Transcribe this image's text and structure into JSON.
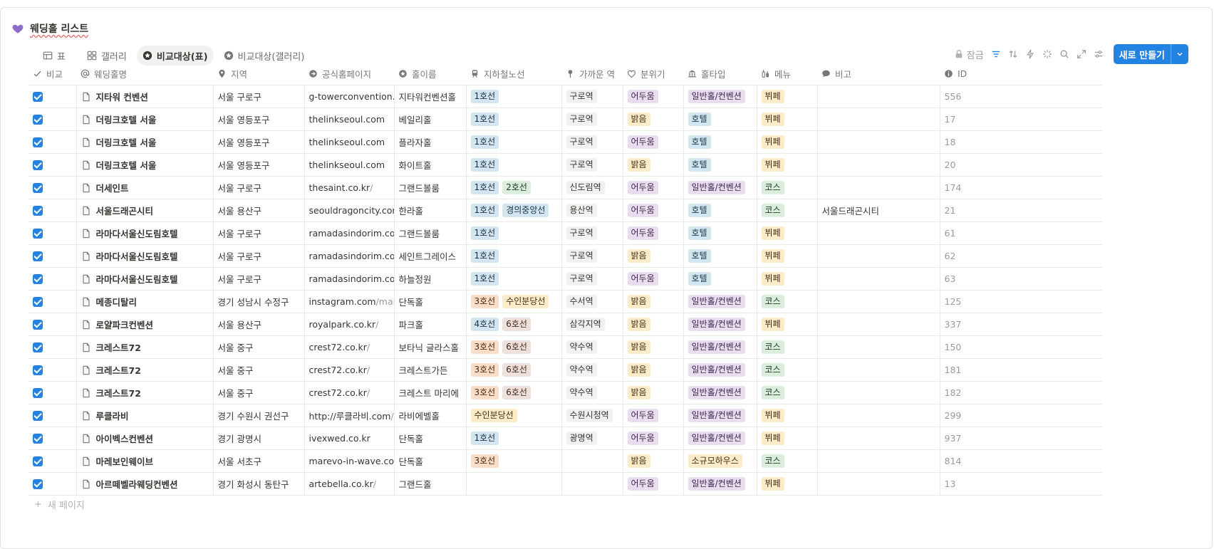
{
  "page": {
    "title": "웨딩홀 리스트",
    "icon": "purple-heart-icon",
    "accent": "#2383e2"
  },
  "views": [
    {
      "label": "표",
      "icon": "table-icon",
      "active": false
    },
    {
      "label": "갤러리",
      "icon": "gallery-icon",
      "active": false
    },
    {
      "label": "비교대상(표)",
      "icon": "star-circle-icon",
      "active": true
    },
    {
      "label": "비교대상(갤러리)",
      "icon": "star-circle-icon",
      "active": false
    }
  ],
  "toolbar": {
    "lock_label": "잠금",
    "new_label": "새로 만들기"
  },
  "columns": [
    {
      "label": "비교",
      "icon": "check-icon"
    },
    {
      "label": "웨딩홀명",
      "icon": "at-icon"
    },
    {
      "label": "지역",
      "icon": "pin-icon"
    },
    {
      "label": "공식홈페이지",
      "icon": "arrow-circle-icon"
    },
    {
      "label": "홀이름",
      "icon": "star-circle-icon"
    },
    {
      "label": "지하철노선",
      "icon": "train-icon"
    },
    {
      "label": "가까운 역",
      "icon": "pin-icon"
    },
    {
      "label": "분위기",
      "icon": "heart-outline-icon"
    },
    {
      "label": "홀타입",
      "icon": "bank-icon"
    },
    {
      "label": "메뉴",
      "icon": "bottles-icon"
    },
    {
      "label": "비고",
      "icon": "chat-icon"
    },
    {
      "label": "ID",
      "icon": "info-icon"
    }
  ],
  "rows": [
    {
      "name": "지타워 컨벤션",
      "region": "서울 구로구",
      "url": "g-towerconvention.kr",
      "url_rest": "",
      "hall": "지타워컨벤션홀",
      "lines": [
        {
          "t": "1호선",
          "c": "blue"
        }
      ],
      "station": "구로역",
      "mood": {
        "t": "어두움",
        "c": "purple"
      },
      "type": {
        "t": "일반홀/컨벤션",
        "c": "purple"
      },
      "menu": {
        "t": "뷔페",
        "c": "yellow"
      },
      "note": "",
      "id": "556"
    },
    {
      "name": "더링크호텔 서울",
      "region": "서울 영등포구",
      "url": "thelinkseoul.com",
      "url_rest": "",
      "hall": "베일리홀",
      "lines": [
        {
          "t": "1호선",
          "c": "blue"
        }
      ],
      "station": "구로역",
      "mood": {
        "t": "밝음",
        "c": "yellow"
      },
      "type": {
        "t": "호텔",
        "c": "blue"
      },
      "menu": {
        "t": "뷔페",
        "c": "yellow"
      },
      "note": "",
      "id": "17"
    },
    {
      "name": "더링크호텔 서울",
      "region": "서울 영등포구",
      "url": "thelinkseoul.com",
      "url_rest": "",
      "hall": "플라자홀",
      "lines": [
        {
          "t": "1호선",
          "c": "blue"
        }
      ],
      "station": "구로역",
      "mood": {
        "t": "어두움",
        "c": "purple"
      },
      "type": {
        "t": "호텔",
        "c": "blue"
      },
      "menu": {
        "t": "뷔페",
        "c": "yellow"
      },
      "note": "",
      "id": "18"
    },
    {
      "name": "더링크호텔 서울",
      "region": "서울 영등포구",
      "url": "thelinkseoul.com",
      "url_rest": "",
      "hall": "화이트홀",
      "lines": [
        {
          "t": "1호선",
          "c": "blue"
        }
      ],
      "station": "구로역",
      "mood": {
        "t": "밝음",
        "c": "yellow"
      },
      "type": {
        "t": "호텔",
        "c": "blue"
      },
      "menu": {
        "t": "뷔페",
        "c": "yellow"
      },
      "note": "",
      "id": "20"
    },
    {
      "name": "더세인트",
      "region": "서울 구로구",
      "url": "thesaint.co.kr",
      "url_rest": "/",
      "hall": "그랜드볼룸",
      "lines": [
        {
          "t": "1호선",
          "c": "blue"
        },
        {
          "t": "2호선",
          "c": "green"
        }
      ],
      "station": "신도림역",
      "mood": {
        "t": "어두움",
        "c": "purple"
      },
      "type": {
        "t": "일반홀/컨벤션",
        "c": "purple"
      },
      "menu": {
        "t": "코스",
        "c": "green"
      },
      "note": "",
      "id": "174"
    },
    {
      "name": "서울드래곤시티",
      "region": "서울 용산구",
      "url": "seouldragoncity.com",
      "url_rest": "/",
      "hall": "한라홀",
      "lines": [
        {
          "t": "1호선",
          "c": "blue"
        },
        {
          "t": "경의중앙선",
          "c": "blue"
        }
      ],
      "station": "용산역",
      "mood": {
        "t": "어두움",
        "c": "purple"
      },
      "type": {
        "t": "호텔",
        "c": "blue"
      },
      "menu": {
        "t": "코스",
        "c": "green"
      },
      "note": "서울드래곤시티",
      "id": "21"
    },
    {
      "name": "라마다서울신도림호텔",
      "region": "서울 구로구",
      "url": "ramadasindorim.com",
      "url_rest": "/",
      "hall": "그랜드볼룸",
      "lines": [
        {
          "t": "1호선",
          "c": "blue"
        }
      ],
      "station": "구로역",
      "mood": {
        "t": "어두움",
        "c": "purple"
      },
      "type": {
        "t": "호텔",
        "c": "blue"
      },
      "menu": {
        "t": "뷔페",
        "c": "yellow"
      },
      "note": "",
      "id": "61"
    },
    {
      "name": "라마다서울신도림호텔",
      "region": "서울 구로구",
      "url": "ramadasindorim.com",
      "url_rest": "/",
      "hall": "세인트그레이스",
      "lines": [
        {
          "t": "1호선",
          "c": "blue"
        }
      ],
      "station": "구로역",
      "mood": {
        "t": "밝음",
        "c": "yellow"
      },
      "type": {
        "t": "호텔",
        "c": "blue"
      },
      "menu": {
        "t": "뷔페",
        "c": "yellow"
      },
      "note": "",
      "id": "62"
    },
    {
      "name": "라마다서울신도림호텔",
      "region": "서울 구로구",
      "url": "ramadasindorim.com",
      "url_rest": "/",
      "hall": "하늘정원",
      "lines": [
        {
          "t": "1호선",
          "c": "blue"
        }
      ],
      "station": "구로역",
      "mood": {
        "t": "어두움",
        "c": "purple"
      },
      "type": {
        "t": "호텔",
        "c": "blue"
      },
      "menu": {
        "t": "뷔페",
        "c": "yellow"
      },
      "note": "",
      "id": "63"
    },
    {
      "name": "메종디탈리",
      "region": "경기 성남시 수정구",
      "url": "instagram.com",
      "url_rest": "/mai...ta",
      "hall": "단독홀",
      "lines": [
        {
          "t": "3호선",
          "c": "orange"
        },
        {
          "t": "수인분당선",
          "c": "yellow"
        }
      ],
      "station": "수서역",
      "mood": {
        "t": "밝음",
        "c": "yellow"
      },
      "type": {
        "t": "일반홀/컨벤션",
        "c": "purple"
      },
      "menu": {
        "t": "코스",
        "c": "green"
      },
      "note": "",
      "id": "125"
    },
    {
      "name": "로얄파크컨벤션",
      "region": "서울 용산구",
      "url": "royalpark.co.kr",
      "url_rest": "/",
      "hall": "파크홀",
      "lines": [
        {
          "t": "4호선",
          "c": "blue"
        },
        {
          "t": "6호선",
          "c": "brown"
        }
      ],
      "station": "삼각지역",
      "mood": {
        "t": "밝음",
        "c": "yellow"
      },
      "type": {
        "t": "일반홀/컨벤션",
        "c": "purple"
      },
      "menu": {
        "t": "뷔페",
        "c": "yellow"
      },
      "note": "",
      "id": "337"
    },
    {
      "name": "크레스트72",
      "region": "서울 중구",
      "url": "crest72.co.kr",
      "url_rest": "/",
      "hall": "보타닉 글라스홀",
      "lines": [
        {
          "t": "3호선",
          "c": "orange"
        },
        {
          "t": "6호선",
          "c": "brown"
        }
      ],
      "station": "약수역",
      "mood": {
        "t": "밝음",
        "c": "yellow"
      },
      "type": {
        "t": "일반홀/컨벤션",
        "c": "purple"
      },
      "menu": {
        "t": "코스",
        "c": "green"
      },
      "note": "",
      "id": "150"
    },
    {
      "name": "크레스트72",
      "region": "서울 중구",
      "url": "crest72.co.kr",
      "url_rest": "/",
      "hall": "크레스트가든",
      "lines": [
        {
          "t": "3호선",
          "c": "orange"
        },
        {
          "t": "6호선",
          "c": "brown"
        }
      ],
      "station": "약수역",
      "mood": {
        "t": "밝음",
        "c": "yellow"
      },
      "type": {
        "t": "일반홀/컨벤션",
        "c": "purple"
      },
      "menu": {
        "t": "코스",
        "c": "green"
      },
      "note": "",
      "id": "181"
    },
    {
      "name": "크레스트72",
      "region": "서울 중구",
      "url": "crest72.co.kr",
      "url_rest": "/",
      "hall": "크레스트 마리에",
      "lines": [
        {
          "t": "3호선",
          "c": "orange"
        },
        {
          "t": "6호선",
          "c": "brown"
        }
      ],
      "station": "약수역",
      "mood": {
        "t": "밝음",
        "c": "yellow"
      },
      "type": {
        "t": "일반홀/컨벤션",
        "c": "purple"
      },
      "menu": {
        "t": "코스",
        "c": "green"
      },
      "note": "",
      "id": "182"
    },
    {
      "name": "루클라비",
      "region": "경기 수원시 권선구",
      "url": "http://루클라비.com",
      "url_rest": "/",
      "hall": "라비에벨홀",
      "lines": [
        {
          "t": "수인분당선",
          "c": "yellow"
        }
      ],
      "station": "수원시청역",
      "mood": {
        "t": "어두움",
        "c": "purple"
      },
      "type": {
        "t": "일반홀/컨벤션",
        "c": "purple"
      },
      "menu": {
        "t": "뷔페",
        "c": "yellow"
      },
      "note": "",
      "id": "299"
    },
    {
      "name": "아이벡스컨벤션",
      "region": "경기 광명시",
      "url": "ivexwed.co.kr",
      "url_rest": "",
      "hall": "단독홀",
      "lines": [
        {
          "t": "1호선",
          "c": "blue"
        }
      ],
      "station": "광명역",
      "mood": {
        "t": "어두움",
        "c": "purple"
      },
      "type": {
        "t": "일반홀/컨벤션",
        "c": "purple"
      },
      "menu": {
        "t": "뷔페",
        "c": "yellow"
      },
      "note": "",
      "id": "937"
    },
    {
      "name": "마레보인웨이브",
      "region": "서울 서초구",
      "url": "marevo-in-wave.com",
      "url_rest": "/",
      "hall": "단독홀",
      "lines": [
        {
          "t": "3호선",
          "c": "orange"
        }
      ],
      "station": "",
      "mood": {
        "t": "밝음",
        "c": "yellow"
      },
      "type": {
        "t": "소규모하우스",
        "c": "yellow"
      },
      "menu": {
        "t": "코스",
        "c": "green"
      },
      "note": "",
      "id": "814"
    },
    {
      "name": "아르떼벨라웨딩컨벤션",
      "region": "경기 화성시 동탄구",
      "url": "artebella.co.kr",
      "url_rest": "/",
      "hall": "그랜드홀",
      "lines": [],
      "station": "",
      "mood": {
        "t": "어두움",
        "c": "purple"
      },
      "type": {
        "t": "일반홀/컨벤션",
        "c": "purple"
      },
      "menu": {
        "t": "뷔페",
        "c": "yellow"
      },
      "note": "",
      "id": "13"
    }
  ],
  "footer": {
    "add_label": "새 페이지"
  }
}
